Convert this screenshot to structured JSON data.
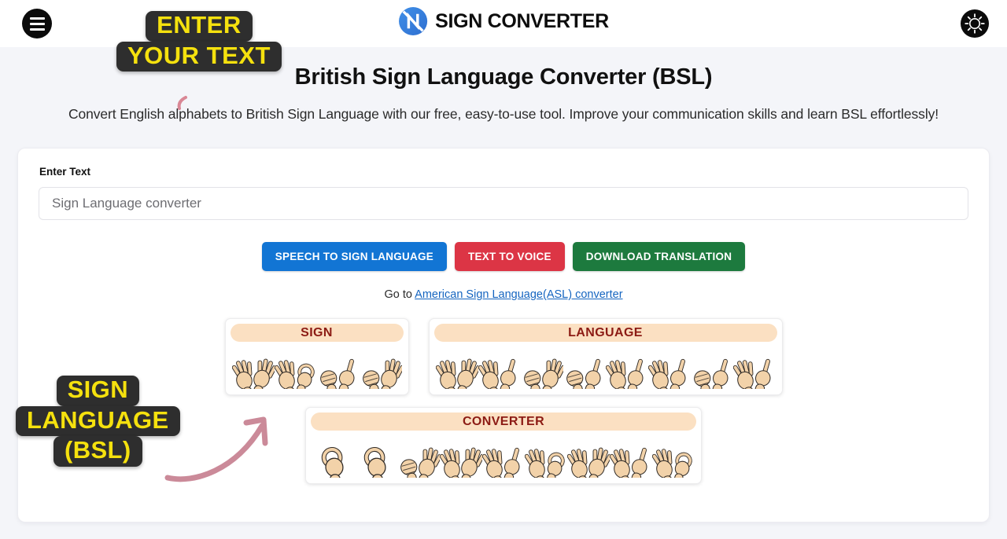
{
  "header": {
    "menu_icon": "hamburger-icon",
    "brand_name": "SIGN CONVERTER",
    "brand_logo_icon": "n-monogram-logo",
    "theme_icon": "sun-brightness-icon"
  },
  "hero": {
    "title": "British Sign Language Converter (BSL)",
    "subtitle": "Convert English alphabets to British Sign Language with our free, easy-to-use tool. Improve your communication skills and learn BSL effortlessly!"
  },
  "form": {
    "label": "Enter Text",
    "value": "Sign Language converter",
    "placeholder": "Sign Language converter"
  },
  "buttons": {
    "speech_to_sign": "SPEECH TO SIGN LANGUAGE",
    "text_to_voice": "TEXT TO VOICE",
    "download_translation": "DOWNLOAD TRANSLATION",
    "colors": {
      "speech_to_sign": "#1275d4",
      "text_to_voice": "#dc3545",
      "download_translation": "#1d7a3e"
    }
  },
  "goto": {
    "prefix": "Go to",
    "link_label": "American Sign Language(ASL) converter",
    "link_color": "#1565c0"
  },
  "translation": {
    "rows": [
      {
        "words": [
          {
            "label": "SIGN",
            "letters": [
              "S",
              "I",
              "G",
              "N"
            ]
          },
          {
            "label": "LANGUAGE",
            "letters": [
              "L",
              "A",
              "N",
              "G",
              "U",
              "A",
              "G",
              "E"
            ]
          }
        ]
      },
      {
        "words": [
          {
            "label": "CONVERTER",
            "letters": [
              "C",
              "O",
              "N",
              "V",
              "E",
              "R",
              "T",
              "E",
              "R"
            ]
          }
        ]
      }
    ],
    "header_bg": "#fbe0c2",
    "header_text_color": "#8c1b14"
  },
  "annotations": {
    "enter_text": {
      "line1": "ENTER",
      "line2": "YOUR TEXT"
    },
    "sign_language": {
      "line1": "SIGN",
      "line2": "LANGUAGE",
      "line3": "(BSL)"
    },
    "arrow_icon": "curved-arrow-icon",
    "text_color": "#f5e10e",
    "bg_color": "#2e2e2e",
    "arrow_color": "#cc8899"
  }
}
